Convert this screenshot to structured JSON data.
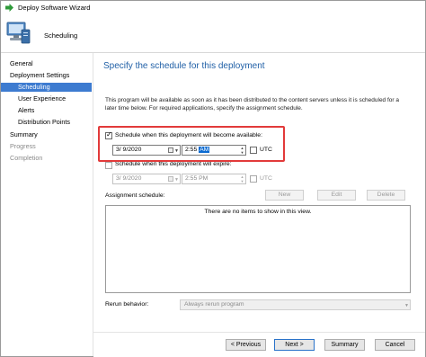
{
  "window": {
    "title": "Deploy Software Wizard"
  },
  "header": {
    "title": "Scheduling"
  },
  "nav": {
    "items": [
      {
        "label": "General",
        "state": "normal"
      },
      {
        "label": "Deployment Settings",
        "state": "normal"
      },
      {
        "label": "Scheduling",
        "state": "selected"
      },
      {
        "label": "User Experience",
        "state": "normal"
      },
      {
        "label": "Alerts",
        "state": "normal"
      },
      {
        "label": "Distribution Points",
        "state": "normal"
      },
      {
        "label": "Summary",
        "state": "normal"
      },
      {
        "label": "Progress",
        "state": "disabled"
      },
      {
        "label": "Completion",
        "state": "disabled"
      }
    ]
  },
  "main": {
    "title": "Specify the schedule for this deployment",
    "description": "This program will be available as soon as it has been distributed to the content servers unless it is scheduled for a later time below. For required applications, specify the assignment schedule.",
    "available": {
      "label": "Schedule when this deployment will become available:",
      "checked": true,
      "date": "3/  9/2020",
      "time_prefix": "2:55",
      "time_selected": "AM",
      "utc_label": "UTC"
    },
    "expire": {
      "label": "Schedule when this deployment will expire:",
      "checked": false,
      "date": "3/  9/2020",
      "time": "2:55 PM",
      "utc_label": "UTC"
    },
    "assignment": {
      "label": "Assignment schedule:",
      "new_label": "New",
      "edit_label": "Edit",
      "delete_label": "Delete",
      "empty_message": "There are no items to show in this view."
    },
    "rerun": {
      "label": "Rerun behavior:",
      "value": "Always rerun program"
    }
  },
  "footer": {
    "previous_label": "< Previous",
    "next_label": "Next >",
    "summary_label": "Summary",
    "cancel_label": "Cancel"
  },
  "colors": {
    "accent": "#3d7bd0",
    "title_blue": "#1f5fa6",
    "highlight_box": "#e23a3a"
  }
}
